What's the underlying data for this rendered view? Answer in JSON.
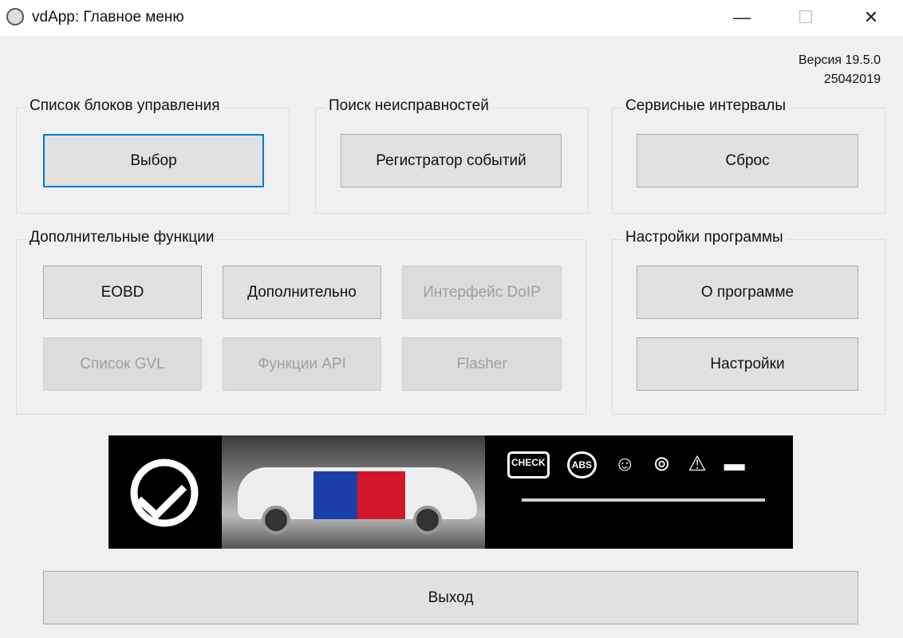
{
  "window": {
    "title": "vdApp:  Главное меню",
    "minimize": "—",
    "maximize": "☐",
    "close": "✕"
  },
  "version": {
    "label": "Версия 19.5.0",
    "build": "25042019"
  },
  "groups": {
    "control_units": {
      "label": "Список блоков управления",
      "select": "Выбор"
    },
    "diagnostics": {
      "label": "Поиск неисправностей",
      "event_recorder": "Регистратор событий"
    },
    "service": {
      "label": "Сервисные интервалы",
      "reset": "Сброс"
    },
    "extra": {
      "label": "Дополнительные функции",
      "eobd": "EOBD",
      "additional": "Дополнительно",
      "doip": "Интерфейс DoIP",
      "gvl": "Список GVL",
      "api": "Функции API",
      "flasher": "Flasher"
    },
    "settings": {
      "label": "Настройки программы",
      "about": "О программе",
      "settings": "Настройки"
    }
  },
  "banner": {
    "icons": [
      "check-engine-icon",
      "abs-icon",
      "airbag-icon",
      "steering-icon",
      "warning-icon",
      "battery-icon"
    ],
    "check_text": "CHECK",
    "abs_text": "ABS"
  },
  "exit": "Выход"
}
